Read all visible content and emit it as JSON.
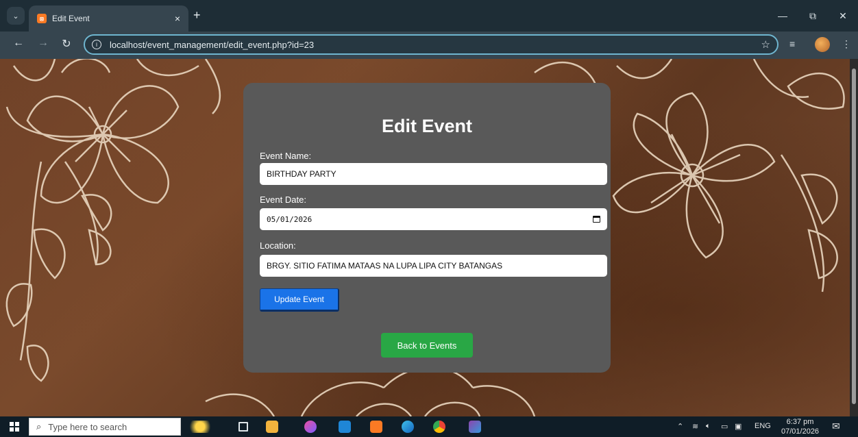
{
  "browser": {
    "tab": {
      "title": "Edit Event",
      "favicon_label": "⦻",
      "close_glyph": "×"
    },
    "new_tab_glyph": "+",
    "window_controls": {
      "minimize": "—",
      "restore": "⧉",
      "close": "✕"
    },
    "nav": {
      "back": "←",
      "forward": "→",
      "reload": "↻"
    },
    "url": "localhost/event_management/edit_event.php?id=23",
    "star_glyph": "☆",
    "reading_glyph": "≡",
    "menu_glyph": "⋮",
    "tab_search_glyph": "⌄"
  },
  "form": {
    "title": "Edit Event",
    "name_label": "Event Name:",
    "name_value": "BIRTHDAY PARTY",
    "date_label": "Event Date:",
    "date_value": "05/01/2026",
    "location_label": "Location:",
    "location_value": "BRGY. SITIO FATIMA MATAAS NA LUPA LIPA CITY BATANGAS",
    "update_button": "Update Event",
    "back_button": "Back to Events"
  },
  "taskbar": {
    "search_glyph": "⌕",
    "search_placeholder": "Type here to search",
    "tray_chevron": "⌃",
    "language": "ENG",
    "time": "6:37 pm",
    "date": "07/01/2026",
    "notification_glyph": "✉"
  },
  "colors": {
    "card": "#595959",
    "update_button": "#1a73e8",
    "back_button": "#29a745",
    "omnibox_border": "#6fb6d0"
  }
}
